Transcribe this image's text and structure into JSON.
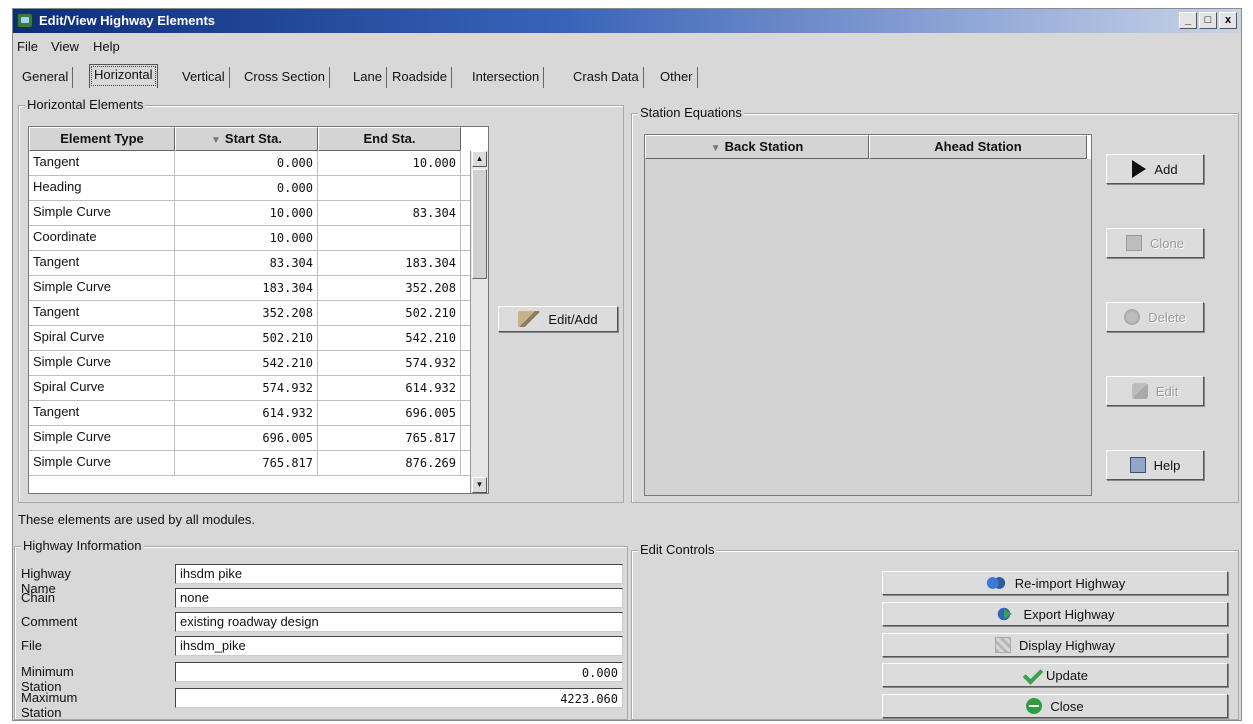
{
  "window": {
    "title": "Edit/View Highway Elements",
    "controls": [
      "_",
      "□",
      "x"
    ]
  },
  "menu": [
    "File",
    "View",
    "Help"
  ],
  "tabs": [
    "General",
    "Horizontal",
    "Vertical",
    "Cross Section",
    "Lane",
    "Roadside",
    "Intersection",
    "Crash Data",
    "Other"
  ],
  "active_tab": "Horizontal",
  "horizontal": {
    "group_title": "Horizontal Elements",
    "columns": [
      "Element Type",
      "Start Sta.",
      "End Sta."
    ],
    "rows": [
      [
        "Tangent",
        "0.000",
        "10.000"
      ],
      [
        "Heading",
        "0.000",
        ""
      ],
      [
        "Simple Curve",
        "10.000",
        "83.304"
      ],
      [
        "Coordinate",
        "10.000",
        ""
      ],
      [
        "Tangent",
        "83.304",
        "183.304"
      ],
      [
        "Simple Curve",
        "183.304",
        "352.208"
      ],
      [
        "Tangent",
        "352.208",
        "502.210"
      ],
      [
        "Spiral Curve",
        "502.210",
        "542.210"
      ],
      [
        "Simple Curve",
        "542.210",
        "574.932"
      ],
      [
        "Spiral Curve",
        "574.932",
        "614.932"
      ],
      [
        "Tangent",
        "614.932",
        "696.005"
      ],
      [
        "Simple Curve",
        "696.005",
        "765.817"
      ],
      [
        "Simple Curve",
        "765.817",
        "876.269"
      ]
    ],
    "edit_add_label": "Edit/Add"
  },
  "station": {
    "group_title": "Station Equations",
    "columns": [
      "Back Station",
      "Ahead Station"
    ],
    "buttons": {
      "add": "Add",
      "clone": "Clone",
      "delete": "Delete",
      "edit": "Edit",
      "help": "Help"
    }
  },
  "note": "These elements are used by all modules.",
  "highway_info": {
    "group_title": "Highway Information",
    "labels": {
      "name": "Highway Name",
      "chain": "Chain",
      "comment": "Comment",
      "file": "File",
      "min_station": "Minimum Station",
      "max_station": "Maximum Station"
    },
    "values": {
      "name": "ihsdm pike",
      "chain": "none",
      "comment": "existing roadway design",
      "file": "ihsdm_pike",
      "min_station": "0.000",
      "max_station": "4223.060"
    }
  },
  "edit_controls": {
    "group_title": "Edit Controls",
    "buttons": {
      "reimport": "Re-import Highway",
      "export": "Export Highway",
      "display": "Display Highway",
      "update": "Update",
      "close": "Close"
    }
  },
  "icons": {
    "add": "arrow-right-icon",
    "clone": "clone-icon",
    "delete": "delete-icon",
    "edit": "edit-icon",
    "help": "help-icon",
    "edit_add": "edit-add-icon",
    "reimport": "reimport-icon",
    "export": "export-icon",
    "display": "display-icon",
    "update": "checkmark-icon",
    "close": "close-circle-icon"
  },
  "colors": {
    "title_bar": "#0b2d7a",
    "window_bg": "#d8d8d8",
    "table_bg": "#ffffff"
  }
}
